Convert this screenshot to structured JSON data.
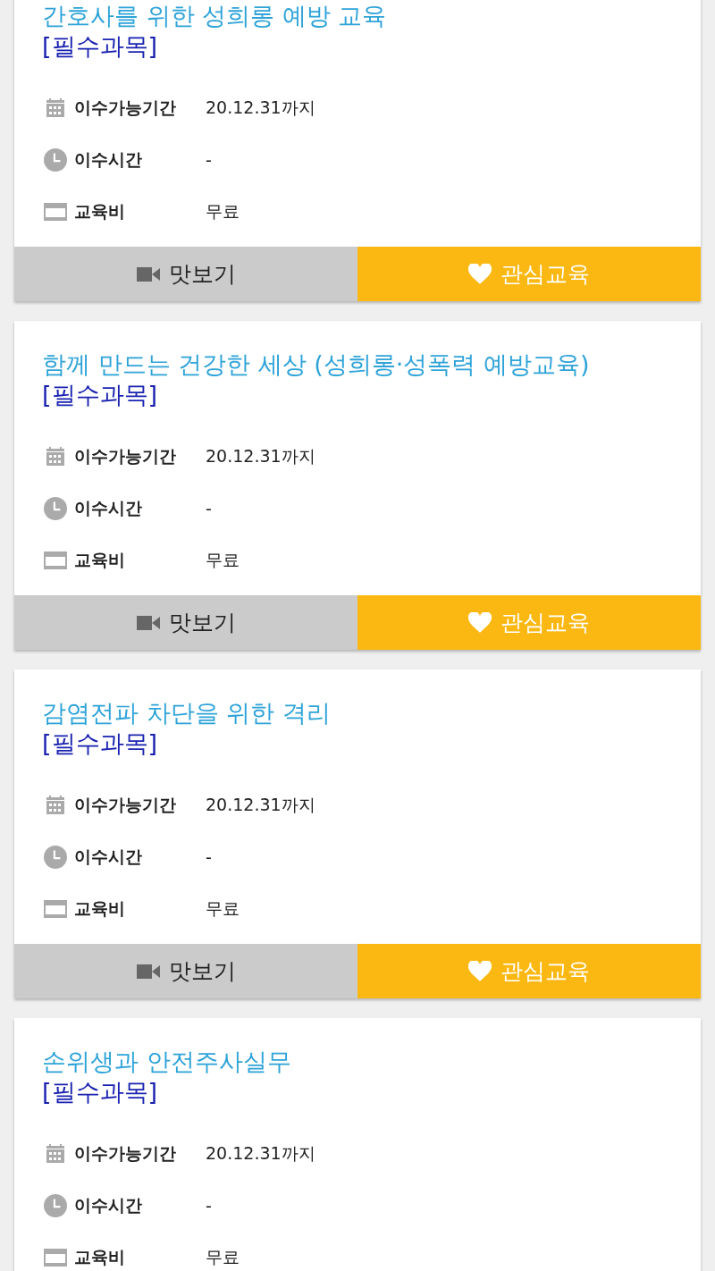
{
  "courses": [
    {
      "title": "간호사를 위한 성희롱 예방 교육",
      "tag": "[필수과목]",
      "details": [
        {
          "kind": "period",
          "label": "이수가능기간",
          "value": "20.12.31까지"
        },
        {
          "kind": "time",
          "label": "이수시간",
          "value": "-"
        },
        {
          "kind": "fee",
          "label": "교육비",
          "value": "무료"
        }
      ],
      "buttons": [
        {
          "kind": "preview",
          "label": "맛보기"
        },
        {
          "kind": "interest",
          "label": "관심교육"
        }
      ]
    },
    {
      "title": "함께 만드는 건강한 세상 (성희롱·성폭력 예방교육)",
      "tag": "[필수과목]",
      "details": [
        {
          "kind": "period",
          "label": "이수가능기간",
          "value": "20.12.31까지"
        },
        {
          "kind": "time",
          "label": "이수시간",
          "value": "-"
        },
        {
          "kind": "fee",
          "label": "교육비",
          "value": "무료"
        }
      ],
      "buttons": [
        {
          "kind": "preview",
          "label": "맛보기"
        },
        {
          "kind": "interest",
          "label": "관심교육"
        }
      ]
    },
    {
      "title": "감염전파 차단을 위한 격리",
      "tag": "[필수과목]",
      "details": [
        {
          "kind": "period",
          "label": "이수가능기간",
          "value": "20.12.31까지"
        },
        {
          "kind": "time",
          "label": "이수시간",
          "value": "-"
        },
        {
          "kind": "fee",
          "label": "교육비",
          "value": "무료"
        }
      ],
      "buttons": [
        {
          "kind": "preview",
          "label": "맛보기"
        },
        {
          "kind": "interest",
          "label": "관심교육"
        }
      ]
    },
    {
      "title": "손위생과 안전주사실무",
      "tag": "[필수과목]",
      "details": [
        {
          "kind": "period",
          "label": "이수가능기간",
          "value": "20.12.31까지"
        },
        {
          "kind": "time",
          "label": "이수시간",
          "value": "-"
        },
        {
          "kind": "fee",
          "label": "교육비",
          "value": "무료"
        }
      ]
    }
  ]
}
